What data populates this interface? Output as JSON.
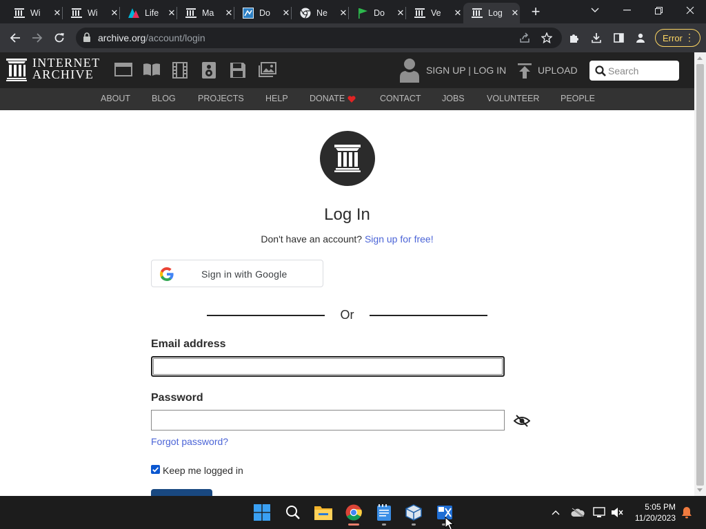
{
  "browser": {
    "tabs": [
      {
        "title": "Wi",
        "favicon": "wikipedia-icon"
      },
      {
        "title": "Wi",
        "favicon": "wikipedia-icon"
      },
      {
        "title": "Life",
        "favicon": "lifehacker-icon"
      },
      {
        "title": "Ma",
        "favicon": "wikipedia-icon"
      },
      {
        "title": "Do",
        "favicon": "doc-icon"
      },
      {
        "title": "Ne",
        "favicon": "chrome-icon"
      },
      {
        "title": "Do",
        "favicon": "flag-icon"
      },
      {
        "title": "Ve",
        "favicon": "wikipedia-icon"
      },
      {
        "title": "Log",
        "favicon": "wikipedia-icon",
        "active": true
      }
    ],
    "url_host": "archive.org",
    "url_path": "/account/login",
    "error_label": "Error"
  },
  "ia_header": {
    "wordmark_line1": "INTERNET",
    "wordmark_line2": "ARCHIVE",
    "media_icons": [
      "web-icon",
      "texts-icon",
      "video-icon",
      "audio-icon",
      "software-icon",
      "images-icon"
    ],
    "signup_login": "SIGN UP | LOG IN",
    "upload": "UPLOAD",
    "search_placeholder": "Search"
  },
  "ia_nav": [
    "ABOUT",
    "BLOG",
    "PROJECTS",
    "HELP",
    "DONATE",
    "CONTACT",
    "JOBS",
    "VOLUNTEER",
    "PEOPLE"
  ],
  "login": {
    "title": "Log In",
    "no_account": "Don't have an account?",
    "signup_link": "Sign up for free!",
    "google_button": "Sign in with Google",
    "or": "Or",
    "email_label": "Email address",
    "email_value": "",
    "password_label": "Password",
    "password_value": "",
    "forgot_link": "Forgot password?",
    "keep_logged_in": "Keep me logged in",
    "keep_checked": true
  },
  "taskbar": {
    "time": "5:05 PM",
    "date": "11/20/2023",
    "apps": [
      "windows-start-icon",
      "search-icon",
      "file-explorer-icon",
      "chrome-icon",
      "notepad-icon",
      "virtualbox-icon",
      "snipping-tool-icon"
    ]
  },
  "colors": {
    "ia_dark": "#222222",
    "ia_nav": "#333333",
    "link_blue": "#4b64d7",
    "login_button": "#194880",
    "chrome_dark": "#202124",
    "error_yellow": "#fdd663"
  }
}
